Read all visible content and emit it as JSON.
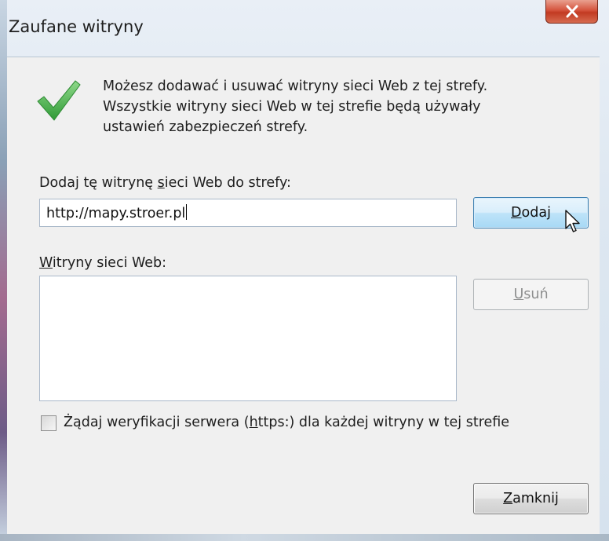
{
  "window": {
    "title": "Zaufane witryny",
    "close_icon": "close-x-icon"
  },
  "info": {
    "icon": "checkmark-icon",
    "line1": "Możesz dodawać i usuwać witryny sieci Web z tej strefy.",
    "line2": "Wszystkie witryny sieci Web w tej strefie będą używały",
    "line3": "ustawień zabezpieczeń strefy."
  },
  "add_section": {
    "label_pre": "Dodaj tę witrynę ",
    "label_key": "s",
    "label_post": "ieci Web do strefy:",
    "input_value": "http://mapy.stroer.pl",
    "add_button_key": "D",
    "add_button_rest": "odaj"
  },
  "list_section": {
    "label_key": "W",
    "label_rest": "itryny sieci Web:",
    "items": [],
    "remove_button_key": "U",
    "remove_button_rest": "suń"
  },
  "https_option": {
    "label_pre": "Żądaj weryfikacji serwera (",
    "label_key": "h",
    "label_post": "ttps:) dla każdej witryny w tej strefie",
    "checked": false
  },
  "footer": {
    "close_button_key": "Z",
    "close_button_rest": "amknij"
  },
  "colors": {
    "accent_button_border": "#3c7fb1",
    "close_button_red": "#c23a22",
    "checkmark_green": "#3aa33a"
  }
}
